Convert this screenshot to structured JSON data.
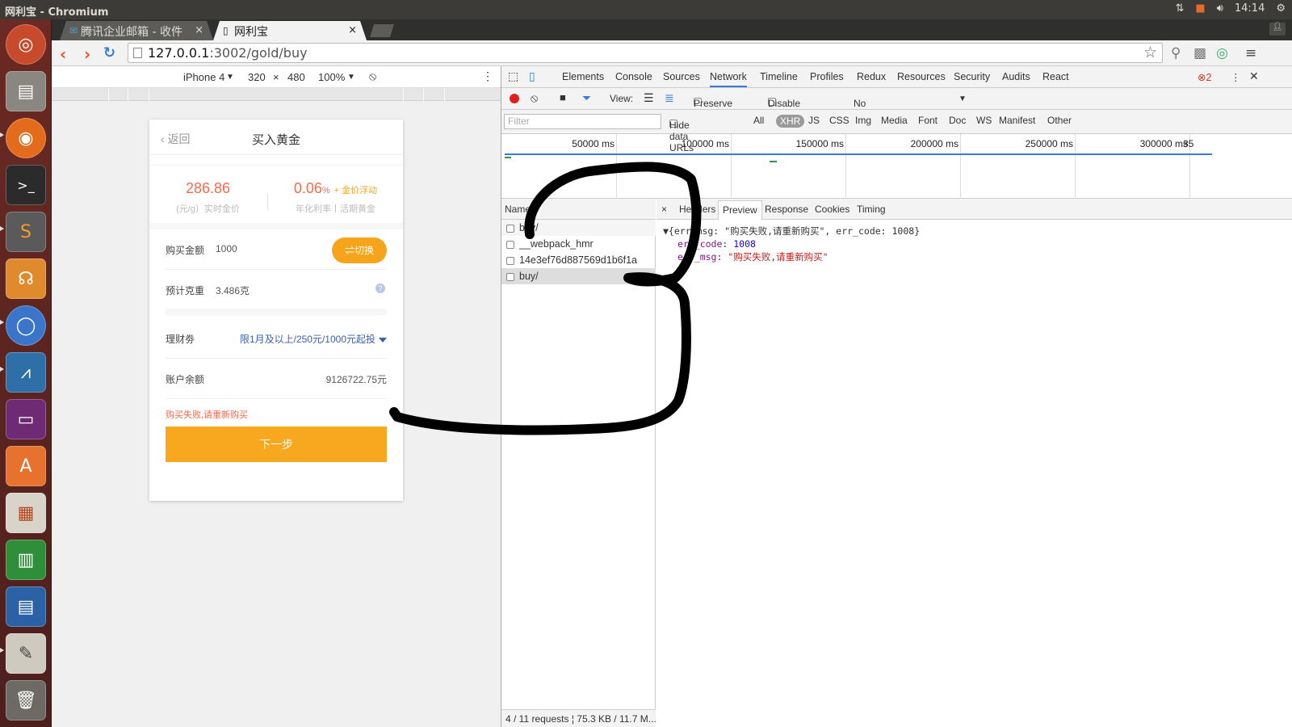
{
  "window_title": "网利宝 - Chromium",
  "tray": {
    "time": "14:14"
  },
  "tabs": [
    {
      "label": "腾讯企业邮箱 - 收件",
      "close": "×"
    },
    {
      "label": "网利宝",
      "close": "×"
    }
  ],
  "address": {
    "host": "127.0.0.1",
    "path": ":3002/gold/buy"
  },
  "device_bar": {
    "device": "iPhone 4",
    "width": "320",
    "times": "×",
    "height": "480",
    "zoom": "100%"
  },
  "page": {
    "back": "返回",
    "title": "买入黄金",
    "price": "286.86",
    "price_caption": "(元/g）实时金价",
    "rate": "0.06",
    "rate_unit": "%",
    "rate_extra": "+ 金价浮动",
    "rate_caption": "年化利率丨活期黄金",
    "amount_label": "购买金额",
    "amount_value": "1000",
    "switch_label": "⇌切换",
    "weight_label": "预计克重",
    "weight_value": "3.486克",
    "help": "?",
    "coupon_label": "理财劵",
    "coupon_value": "限1月及以上/250元/1000元起投",
    "balance_label": "账户余额",
    "balance_value": "9126722.75元",
    "error": "购买失败,请重新购买",
    "next": "下一步"
  },
  "devtools": {
    "tabs": [
      "Elements",
      "Console",
      "Sources",
      "Network",
      "Timeline",
      "Profiles",
      "Redux",
      "Resources",
      "Security",
      "Audits",
      "React"
    ],
    "selected_tab": "Network",
    "error_count": "2",
    "toolbar": {
      "view": "View:",
      "preserve_log": "Preserve log",
      "disable_cache": "Disable cache",
      "throttling": "No throttling"
    },
    "filter_placeholder": "Filter",
    "filter_types": {
      "hide_urls": "Hide data URLs",
      "all": "All",
      "xhr": "XHR",
      "js": "JS",
      "css": "CSS",
      "img": "Img",
      "media": "Media",
      "font": "Font",
      "doc": "Doc",
      "ws": "WS",
      "manifest": "Manifest",
      "other": "Other"
    },
    "timeline_labels": [
      "50000 ms",
      "100000 ms",
      "150000 ms",
      "200000 ms",
      "250000 ms",
      "300000 ms",
      "35"
    ],
    "name_header": "Name",
    "requests": [
      "buy/",
      "__webpack_hmr",
      "14e3ef76d887569d1b6f1a",
      "buy/"
    ],
    "status": "4 / 11 requests  ¦  75.3 KB / 11.7 M...",
    "detail_tabs": [
      "×",
      "Headers",
      "Preview",
      "Response",
      "Cookies",
      "Timing"
    ],
    "preview": {
      "summary": "▼{err_msg: \"购买失败,请重新购买\", err_code: 1008}",
      "k1": "err_code",
      "v1": "1008",
      "k2": "err_msg",
      "v2": "\"购买失败,请重新购买\""
    }
  },
  "colors": {
    "accent_orange": "#f7a81f",
    "price_red": "#f46a4e",
    "link_blue": "#3b5fae",
    "launcher_bg": "#5e2520"
  }
}
